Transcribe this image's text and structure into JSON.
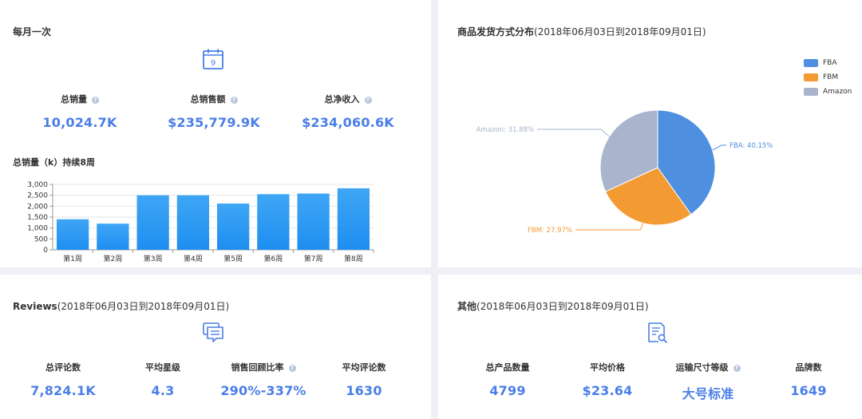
{
  "monthly": {
    "title": "每月一次",
    "calendar_icon_day": "9",
    "stats": [
      {
        "label": "总销量",
        "value": "10,024.7K",
        "help": true
      },
      {
        "label": "总销售额",
        "value": "$235,779.9K",
        "help": true
      },
      {
        "label": "总净收入",
        "value": "$234,060.6K",
        "help": true
      }
    ],
    "bar_title": "总销量（k）持续8周"
  },
  "shipping": {
    "title": "商品发货方式分布",
    "subtitle": "(2018年06月03日到2018年09月01日)"
  },
  "reviews": {
    "title": "Reviews",
    "subtitle": "(2018年06月03日到2018年09月01日)",
    "stats": [
      {
        "label": "总评论数",
        "value": "7,824.1K",
        "help": false
      },
      {
        "label": "平均星级",
        "value": "4.3",
        "help": false
      },
      {
        "label": "销售回顾比率",
        "value": "290%-337%",
        "help": true
      },
      {
        "label": "平均评论数",
        "value": "1630",
        "help": false
      }
    ]
  },
  "other": {
    "title": "其他",
    "subtitle": "(2018年06月03日到2018年09月01日)",
    "stats": [
      {
        "label": "总产品数量",
        "value": "4799",
        "help": false
      },
      {
        "label": "平均价格",
        "value": "$23.64",
        "help": false
      },
      {
        "label": "运输尺寸等级",
        "value": "大号标准",
        "help": true
      },
      {
        "label": "品牌数",
        "value": "1649",
        "help": false
      }
    ]
  },
  "help_glyph": "?",
  "colors": {
    "accent": "#4a7ee8",
    "bar": "#1e8ef0",
    "fba": "#4e8fe0",
    "fbm": "#f39a33",
    "amazon": "#aab4cc"
  },
  "chart_data": [
    {
      "type": "bar",
      "categories": [
        "第1周",
        "第2周",
        "第3周",
        "第4周",
        "第5周",
        "第6周",
        "第7周",
        "第8周"
      ],
      "values": [
        1400,
        1200,
        2500,
        2500,
        2120,
        2550,
        2580,
        2820
      ],
      "y_ticks": [
        "0",
        "500",
        "1,000",
        "1,500",
        "2,000",
        "2,500",
        "3,000"
      ],
      "ylim": [
        0,
        3000
      ],
      "grid": true
    },
    {
      "type": "pie",
      "labels": [
        "FBA",
        "FBM",
        "Amazon"
      ],
      "values": [
        40.15,
        27.97,
        31.88
      ],
      "slice_labels": [
        "FBA: 40.15%",
        "FBM: 27.97%",
        "Amazon: 31.88%"
      ],
      "legend": [
        "FBA",
        "FBM",
        "Amazon"
      ],
      "legend_position": "top-right"
    }
  ]
}
